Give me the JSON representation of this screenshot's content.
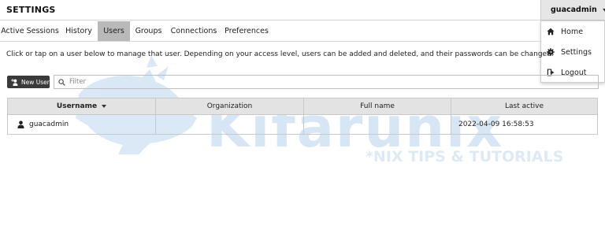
{
  "header": {
    "title": "SETTINGS"
  },
  "user_menu": {
    "username": "guacadmin",
    "items": [
      {
        "label": "Home",
        "icon": "home-icon"
      },
      {
        "label": "Settings",
        "icon": "gear-icon"
      },
      {
        "label": "Logout",
        "icon": "logout-icon"
      }
    ]
  },
  "tabs": [
    {
      "label": "Active Sessions",
      "active": false
    },
    {
      "label": "History",
      "active": false
    },
    {
      "label": "Users",
      "active": true
    },
    {
      "label": "Groups",
      "active": false
    },
    {
      "label": "Connections",
      "active": false
    },
    {
      "label": "Preferences",
      "active": false
    }
  ],
  "instructions": "Click or tap on a user below to manage that user. Depending on your access level, users can be added and deleted, and their passwords can be changed.",
  "toolbar": {
    "new_user_label": "New User",
    "filter_placeholder": "Filter",
    "filter_value": ""
  },
  "table": {
    "columns": [
      "Username",
      "Organization",
      "Full name",
      "Last active"
    ],
    "sorted_column": "Username",
    "rows": [
      {
        "username": "guacadmin",
        "organization": "",
        "full_name": "",
        "last_active": "2022-04-09 16:58:53"
      }
    ]
  },
  "watermark": {
    "brand": "Kifarunix",
    "tagline": "*NIX TIPS & TUTORIALS"
  },
  "colors": {
    "active_tab": "#b9b9b9",
    "header_bg": "#e3e3e3",
    "new_user_button": "#3a3a3a",
    "watermark_blue": "#5b9bd5"
  }
}
